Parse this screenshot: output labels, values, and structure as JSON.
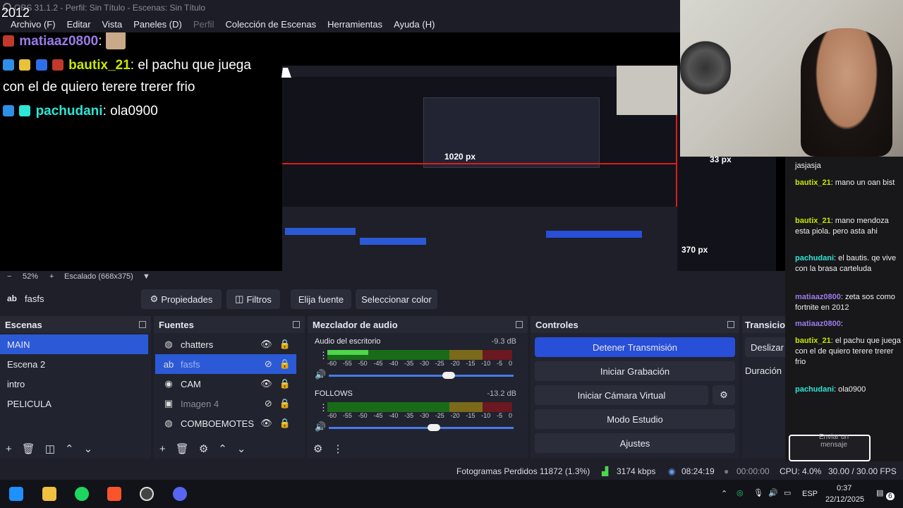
{
  "window": {
    "title": "OBS 31.1.2 - Perfil: Sin Título - Escenas: Sin Título",
    "overlay_year": "2012"
  },
  "menu": [
    "Archivo (F)",
    "Editar",
    "Vista",
    "Paneles (D)",
    "Perfil",
    "Colección de Escenas",
    "Herramientas",
    "Ayuda (H)"
  ],
  "preview_chat": [
    {
      "user": "matiaaz0800",
      "text": ":",
      "color": "#9147ff"
    },
    {
      "user": "bautix_21",
      "text": ": el pachu que juega",
      "color": "#c8e600"
    },
    {
      "user": "",
      "text": "con el de quiero terere trerer frio",
      "color": "#ffffff"
    },
    {
      "user": "pachudani",
      "text": ": ola0900",
      "color": "#2ee6d6"
    }
  ],
  "nested_preview": {
    "px_label_1": "1020 px",
    "px_label_2": "370 px",
    "px_label_3": "33 px"
  },
  "twitch_chat": [
    {
      "user": "",
      "text": "jasjasja"
    },
    {
      "user": "bautix_21",
      "text": ": mano un oan bist"
    },
    {
      "user": "bautix_21",
      "text": ": mano mendoza esta piola. pero asta ahi"
    },
    {
      "user": "pachudani",
      "text": ": el bautis. qe vive con la brasa carteluda"
    },
    {
      "user": "matiaaz0800",
      "text": ": zeta sos como fortnite en 2012"
    },
    {
      "user": "matiaaz0800",
      "text": ":"
    },
    {
      "user": "bautix_21",
      "text": ": el pachu que juega con el de quiero terere trerer frio"
    },
    {
      "user": "pachudani",
      "text": ": ola0900"
    }
  ],
  "chat_input": {
    "placeholder": "Enviar un mensaje"
  },
  "zoom": {
    "minus": "−",
    "value": "52%",
    "plus": "+",
    "scale": "Escalado (668x375)"
  },
  "source_toolbar": {
    "source_name": "fasfs",
    "properties": "Propiedades",
    "filters": "Filtros",
    "choose_source": "Elija fuente",
    "select_color": "Seleccionar color"
  },
  "scenes": {
    "title": "Escenas",
    "items": [
      "MAIN",
      "Escena 2",
      "intro",
      "PELICULA"
    ]
  },
  "sources": {
    "title": "Fuentes",
    "items": [
      {
        "name": "chatters",
        "icon": "browser-icon",
        "visible": true
      },
      {
        "name": "fasfs",
        "icon": "text-icon",
        "visible": false
      },
      {
        "name": "CAM",
        "icon": "camera-icon",
        "visible": true
      },
      {
        "name": "Imagen 4",
        "icon": "image-icon",
        "visible": false
      },
      {
        "name": "COMBOEMOTES",
        "icon": "browser-icon",
        "visible": true
      }
    ]
  },
  "mixer": {
    "title": "Mezclador de audio",
    "tracks": [
      {
        "name": "Audio del escritorio",
        "db": "-9.3 dB",
        "level": 0.22,
        "volume": 0.65
      },
      {
        "name": "FOLLOWS",
        "db": "-13.2 dB",
        "level": 0,
        "volume": 0.57
      }
    ],
    "scale": [
      "-60",
      "-55",
      "-50",
      "-45",
      "-40",
      "-35",
      "-30",
      "-25",
      "-20",
      "-15",
      "-10",
      "-5",
      "0"
    ]
  },
  "controls": {
    "title": "Controles",
    "stop_stream": "Detener Transmisión",
    "start_recording": "Iniciar Grabación",
    "start_virtual_cam": "Iniciar Cámara Virtual",
    "studio_mode": "Modo Estudio",
    "settings": "Ajustes"
  },
  "transitions": {
    "title": "Transicio",
    "type": "Deslizar",
    "duration_label": "Duración"
  },
  "status": {
    "dropped": "Fotogramas Perdidos 11872 (1.3%)",
    "bitrate": "3174 kbps",
    "stream_time": "08:24:19",
    "rec_time": "00:00:00",
    "cpu": "CPU: 4.0%",
    "fps": "30.00 / 30.00 FPS"
  },
  "taskbar": {
    "lang": "ESP",
    "time": "0:37",
    "date": "22/12/2025",
    "notifications": "6"
  },
  "colors": {
    "accent": "#284fd8",
    "selection": "#2c5ad6",
    "panel": "#21232e",
    "background": "#1e1f29"
  }
}
